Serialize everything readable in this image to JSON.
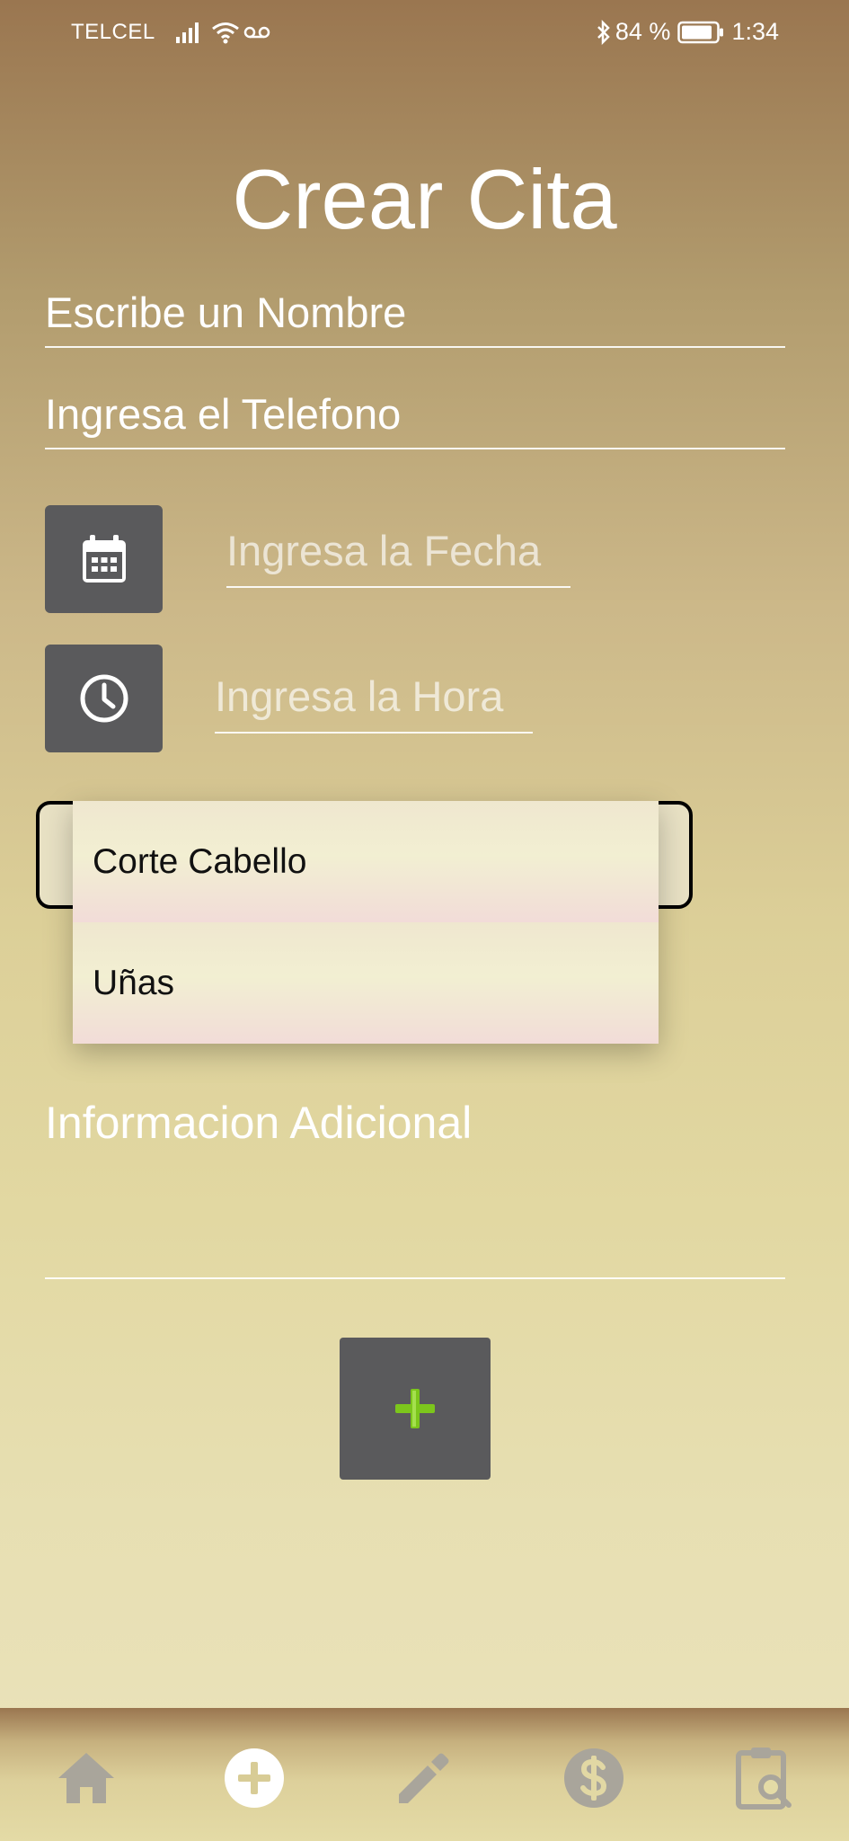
{
  "status_bar": {
    "carrier": "TELCEL",
    "battery": "84 %",
    "time": "1:34"
  },
  "title": "Crear Cita",
  "form": {
    "name_placeholder": "Escribe un Nombre",
    "phone_placeholder": "Ingresa el Telefono",
    "date_placeholder": "Ingresa la Fecha",
    "time_placeholder": "Ingresa la Hora",
    "info_placeholder": "Informacion Adicional"
  },
  "service_dropdown": {
    "options": [
      "Corte Cabello",
      "Uñas"
    ]
  },
  "nav": {
    "items": [
      "home",
      "add",
      "edit",
      "payments",
      "search-appointments"
    ]
  },
  "colors": {
    "button_bg": "#5a5a5c",
    "add_icon": "#7cc61c",
    "nav_icon": "#a9a59b"
  }
}
